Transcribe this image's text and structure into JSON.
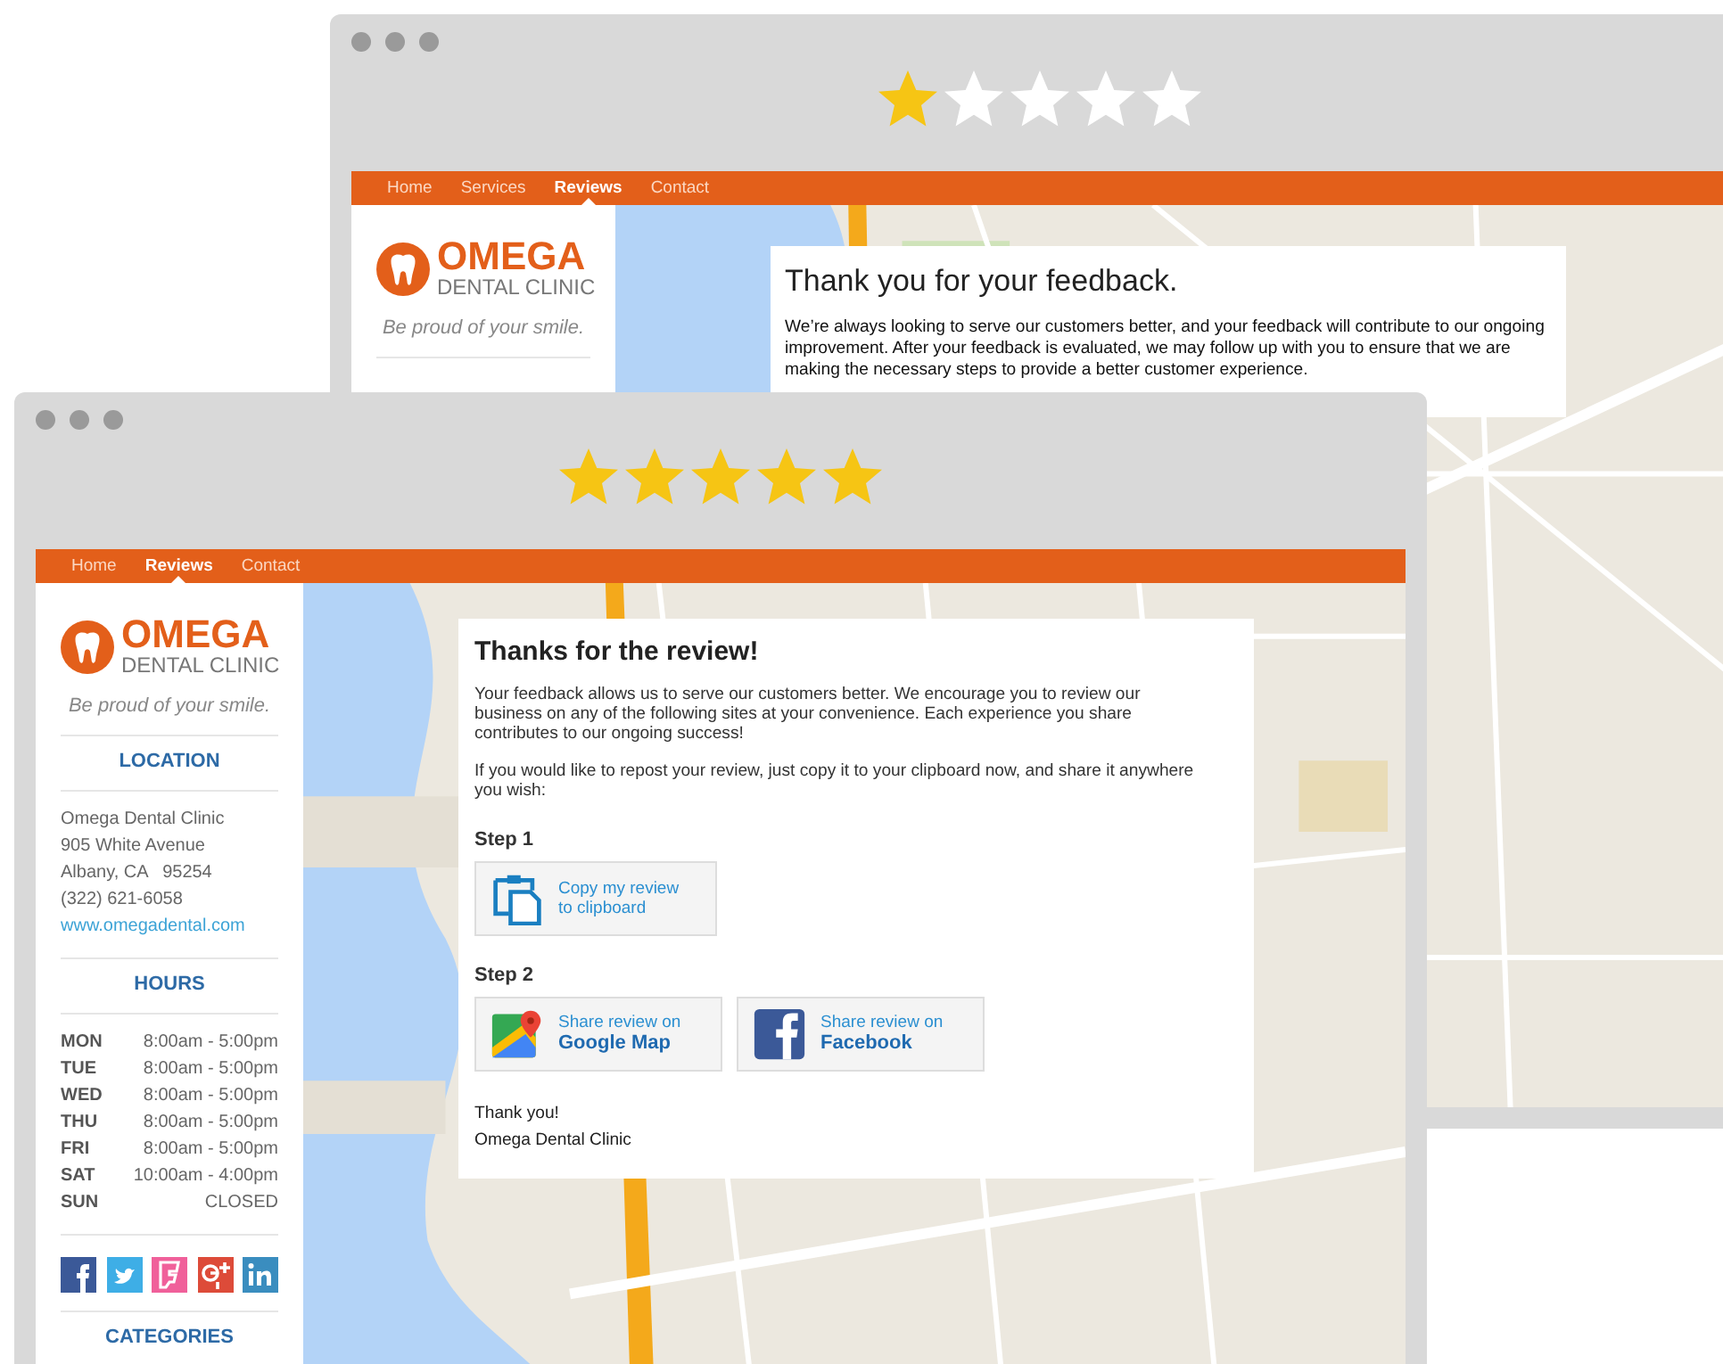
{
  "back_window": {
    "stars": 1,
    "nav": [
      {
        "label": "Home",
        "selected": false
      },
      {
        "label": "Services",
        "selected": false
      },
      {
        "label": "Reviews",
        "selected": true
      },
      {
        "label": "Contact",
        "selected": false
      }
    ],
    "logo": {
      "name": "OMEGA",
      "subtitle": "DENTAL CLINIC"
    },
    "tagline": "Be proud of your smile.",
    "card": {
      "title": "Thank you for your feedback.",
      "body": "We’re always looking to serve our customers better, and your feedback will contribute to our ongoing improvement. After your feedback is evaluated, we may follow up with you to ensure that we are making the necessary steps to provide a better customer experience."
    }
  },
  "front_window": {
    "stars": 5,
    "nav": [
      {
        "label": "Home",
        "selected": false
      },
      {
        "label": "Reviews",
        "selected": true
      },
      {
        "label": "Contact",
        "selected": false
      }
    ],
    "logo": {
      "name": "OMEGA",
      "subtitle": "DENTAL CLINIC"
    },
    "tagline": "Be proud of your smile.",
    "location": {
      "heading": "LOCATION",
      "lines": [
        "Omega Dental Clinic",
        "905 White Avenue",
        "Albany, CA   95254",
        "(322) 621-6058"
      ],
      "website": "www.omegadental.com"
    },
    "hours": {
      "heading": "HOURS",
      "rows": [
        {
          "day": "MON",
          "time": "8:00am - 5:00pm"
        },
        {
          "day": "TUE",
          "time": "8:00am - 5:00pm"
        },
        {
          "day": "WED",
          "time": "8:00am - 5:00pm"
        },
        {
          "day": "THU",
          "time": "8:00am - 5:00pm"
        },
        {
          "day": "FRI",
          "time": "8:00am - 5:00pm"
        },
        {
          "day": "SAT",
          "time": "10:00am - 4:00pm"
        },
        {
          "day": "SUN",
          "time": "CLOSED"
        }
      ]
    },
    "social": [
      {
        "kind": "facebook"
      },
      {
        "kind": "twitter"
      },
      {
        "kind": "foursquare"
      },
      {
        "kind": "googleplus"
      },
      {
        "kind": "linkedin"
      }
    ],
    "categories_heading": "CATEGORIES",
    "card": {
      "title": "Thanks for the review!",
      "paragraphs": [
        "Your feedback allows us to serve our customers better. We encourage you to review our business on any of the following sites at your convenience. Each experience you share contributes to our ongoing success!",
        "If you would like to repost your review, just copy it to your clipboard now, and share it anywhere you wish:"
      ],
      "step1": {
        "label": "Step 1",
        "buttons": [
          {
            "kind": "clipboard",
            "line1": "Copy my review",
            "line2": "to clipboard"
          }
        ]
      },
      "step2": {
        "label": "Step 2",
        "buttons": [
          {
            "kind": "googlemap",
            "line1": "Share review on",
            "line2": "Google Map"
          },
          {
            "kind": "facebook",
            "line1": "Share review on",
            "line2": "Facebook"
          }
        ]
      },
      "closing": [
        "Thank you!",
        "Omega Dental Clinic"
      ]
    }
  }
}
